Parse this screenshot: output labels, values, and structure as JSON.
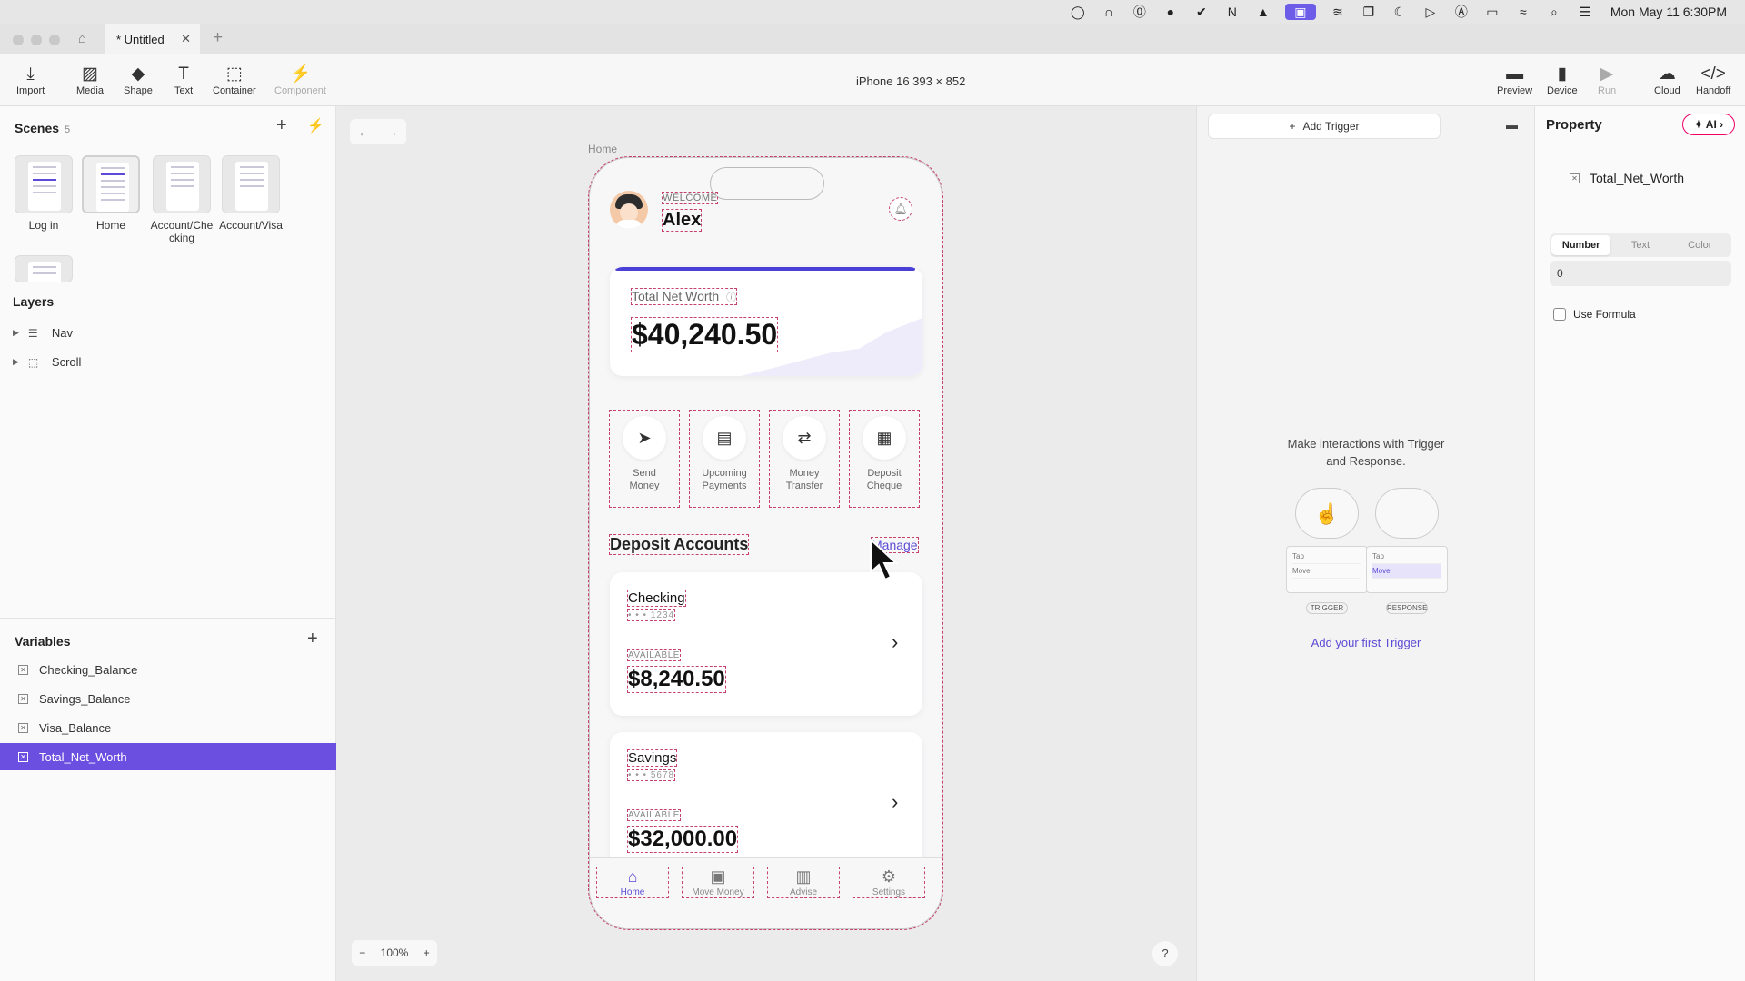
{
  "menubar": {
    "clock": "Mon May 11  6:30PM"
  },
  "tabbar": {
    "tab_title": "* Untitled"
  },
  "toolbar": {
    "tools": [
      "Import",
      "Media",
      "Shape",
      "Text",
      "Container",
      "Component"
    ],
    "device": "iPhone 16  393 × 852",
    "right_tools": [
      "Preview",
      "Device",
      "Run",
      "Cloud",
      "Handoff"
    ]
  },
  "sidebar": {
    "scenes_title": "Scenes",
    "scenes_count": "5",
    "scenes": [
      "Log in",
      "Home",
      "Account/Checking",
      "Account/Visa"
    ],
    "layers_title": "Layers",
    "layers": [
      "Nav",
      "Scroll"
    ],
    "variables_title": "Variables",
    "variables": [
      "Checking_Balance",
      "Savings_Balance",
      "Visa_Balance",
      "Total_Net_Worth"
    ],
    "selected_variable": "Total_Net_Worth"
  },
  "canvas": {
    "frame_label": "Home",
    "zoom": "100%",
    "help": "?"
  },
  "phone": {
    "welcome": "WELCOME",
    "user": "Alex",
    "net_worth_label": "Total Net Worth",
    "net_worth_value": "$40,240.50",
    "actions": [
      "Send Money",
      "Upcoming Payments",
      "Money Transfer",
      "Deposit Cheque"
    ],
    "deposit_title": "Deposit Accounts",
    "manage": "Manage",
    "accounts": [
      {
        "name": "Checking",
        "number": "• • • 1234",
        "available": "AVAILABLE",
        "balance": "$8,240.50"
      },
      {
        "name": "Savings",
        "number": "• • • 5678",
        "available": "AVAILABLE",
        "balance": "$32,000.00"
      }
    ],
    "nav": [
      "Home",
      "Move Money",
      "Advise",
      "Settings"
    ]
  },
  "interactions": {
    "add_trigger": "Add Trigger",
    "empty_message": "Make interactions with Trigger and Response.",
    "trigger_rows": [
      "Tap",
      "Move"
    ],
    "trigger_caption": "TRIGGER",
    "response_caption": "RESPONSE",
    "add_first": "Add your first Trigger"
  },
  "property": {
    "title": "Property",
    "ai": "AI",
    "variable_name": "Total_Net_Worth",
    "types": [
      "Number",
      "Text",
      "Color"
    ],
    "active_type": "Number",
    "value": "0",
    "use_formula": "Use Formula"
  },
  "colors": {
    "accent": "#6b4fe0",
    "brand": "#4b40d6",
    "guide": "#c6426a"
  }
}
